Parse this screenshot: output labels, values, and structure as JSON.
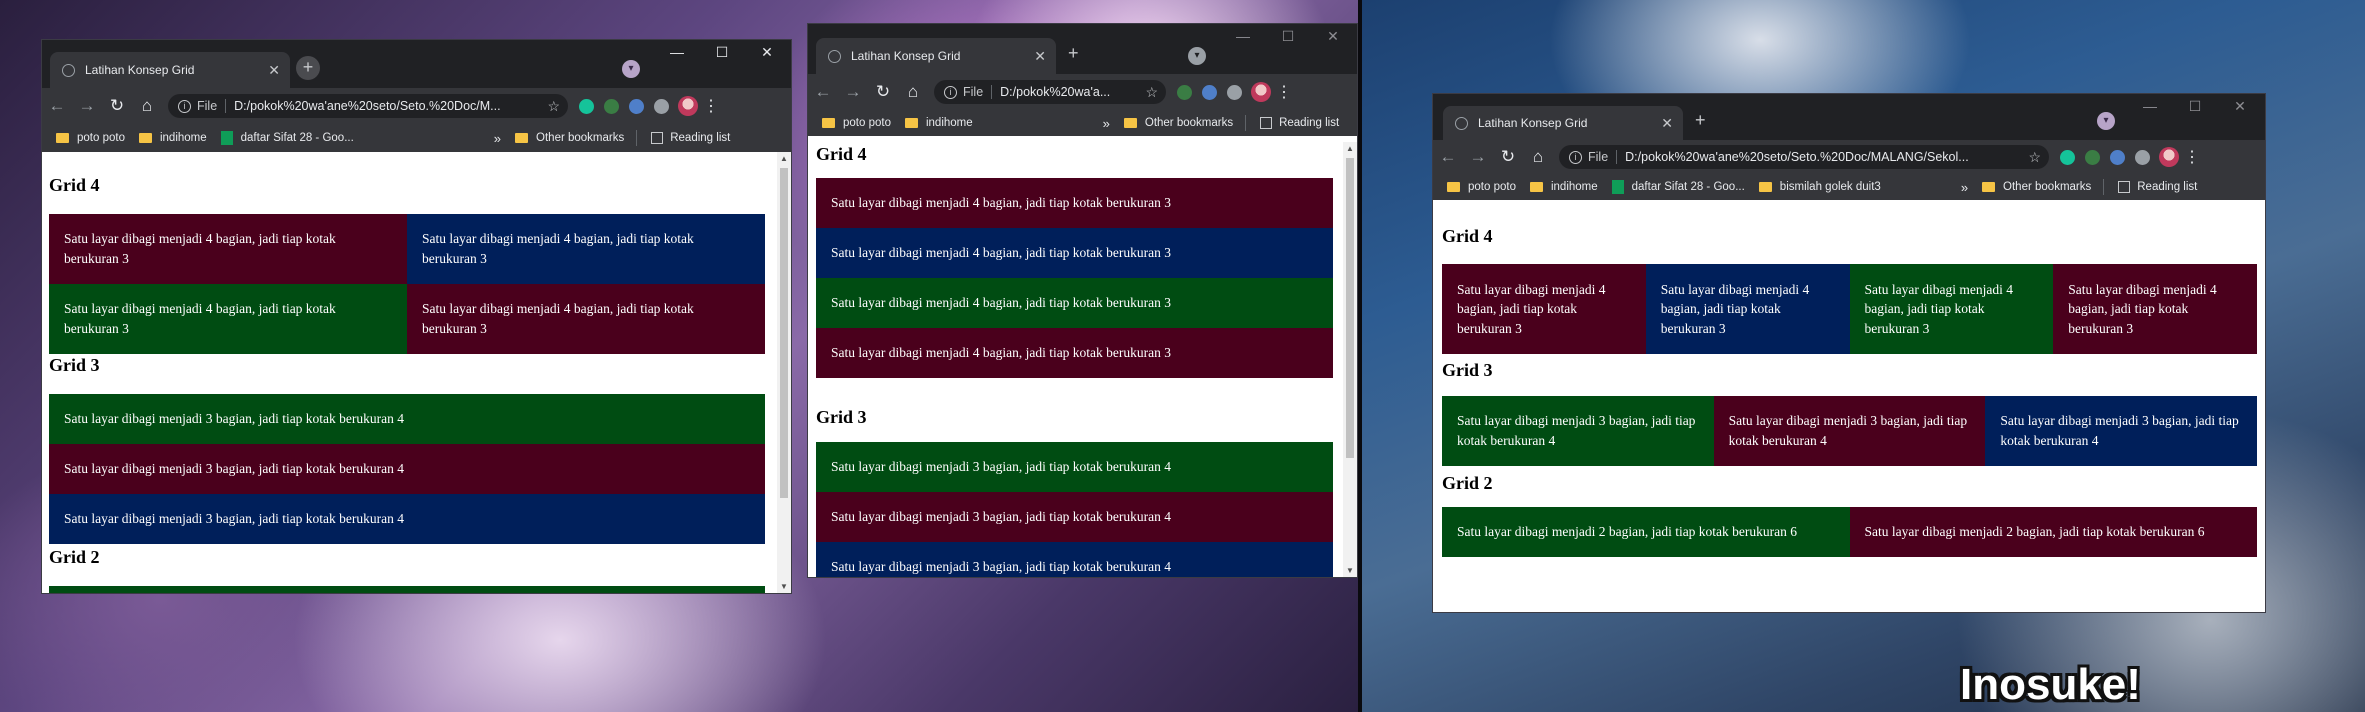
{
  "desktop": {
    "caption": "Inosuke!"
  },
  "browser_common": {
    "file_label": "File",
    "bookmarks": {
      "poto": "poto poto",
      "indihome": "indihome",
      "daftar": "daftar Sifat 28 - Goo...",
      "bismilah": "bismilah golek duit3",
      "other": "Other bookmarks",
      "reading": "Reading list"
    }
  },
  "windows": [
    {
      "tab_title": "Latihan Konsep Grid",
      "url": "D:/pokok%20wa'ane%20seto/Seto.%20Doc/M...",
      "headings": [
        "Grid 4",
        "Grid 3",
        "Grid 2"
      ],
      "grid4": [
        "Satu layar dibagi menjadi 4 bagian, jadi tiap kotak berukuran 3",
        "Satu layar dibagi menjadi 4 bagian, jadi tiap kotak berukuran 3",
        "Satu layar dibagi menjadi 4 bagian, jadi tiap kotak berukuran 3",
        "Satu layar dibagi menjadi 4 bagian, jadi tiap kotak berukuran 3"
      ],
      "grid3": [
        "Satu layar dibagi menjadi 3 bagian, jadi tiap kotak berukuran 4",
        "Satu layar dibagi menjadi 3 bagian, jadi tiap kotak berukuran 4",
        "Satu layar dibagi menjadi 3 bagian, jadi tiap kotak berukuran 4"
      ]
    },
    {
      "tab_title": "Latihan Konsep Grid",
      "url": "D:/pokok%20wa'a...",
      "headings": [
        "Grid 4",
        "Grid 3"
      ],
      "grid4": [
        "Satu layar dibagi menjadi 4 bagian, jadi tiap kotak berukuran 3",
        "Satu layar dibagi menjadi 4 bagian, jadi tiap kotak berukuran 3",
        "Satu layar dibagi menjadi 4 bagian, jadi tiap kotak berukuran 3",
        "Satu layar dibagi menjadi 4 bagian, jadi tiap kotak berukuran 3"
      ],
      "grid3": [
        "Satu layar dibagi menjadi 3 bagian, jadi tiap kotak berukuran 4",
        "Satu layar dibagi menjadi 3 bagian, jadi tiap kotak berukuran 4",
        "Satu layar dibagi menjadi 3 bagian, jadi tiap kotak berukuran 4"
      ]
    },
    {
      "tab_title": "Latihan Konsep Grid",
      "url": "D:/pokok%20wa'ane%20seto/Seto.%20Doc/MALANG/Sekol...",
      "headings": [
        "Grid 4",
        "Grid 3",
        "Grid 2"
      ],
      "grid4": [
        "Satu layar dibagi menjadi 4 bagian, jadi tiap kotak berukuran 3",
        "Satu layar dibagi menjadi 4 bagian, jadi tiap kotak berukuran 3",
        "Satu layar dibagi menjadi 4 bagian, jadi tiap kotak berukuran 3",
        "Satu layar dibagi menjadi 4 bagian, jadi tiap kotak berukuran 3"
      ],
      "grid3": [
        "Satu layar dibagi menjadi 3 bagian, jadi tiap kotak berukuran 4",
        "Satu layar dibagi menjadi 3 bagian, jadi tiap kotak berukuran 4",
        "Satu layar dibagi menjadi 3 bagian, jadi tiap kotak berukuran 4"
      ],
      "grid2": [
        "Satu layar dibagi menjadi 2 bagian, jadi tiap kotak berukuran 6",
        "Satu layar dibagi menjadi 2 bagian, jadi tiap kotak berukuran 6"
      ]
    }
  ],
  "colors": {
    "maroon": "#4a001c",
    "navy": "#001f5a",
    "green": "#004c12"
  }
}
